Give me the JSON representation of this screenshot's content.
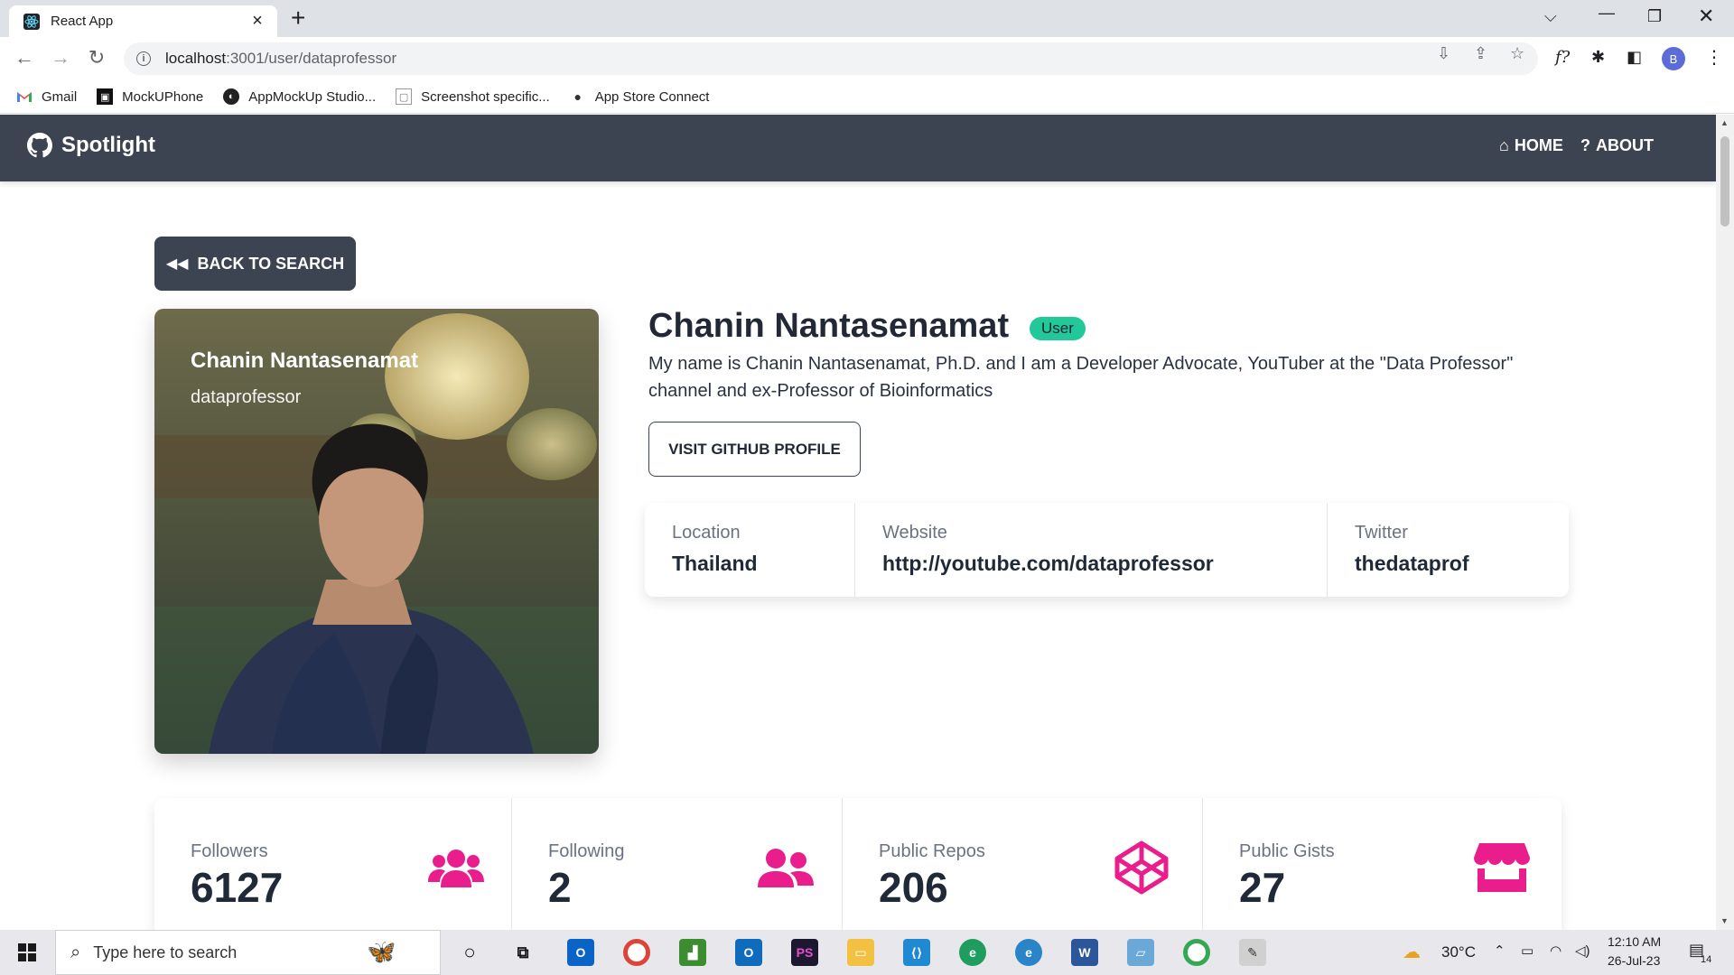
{
  "browser": {
    "tab_title": "React App",
    "url_host": "localhost",
    "url_rest": ":3001/user/dataprofessor",
    "profile_initial": "B",
    "bookmarks": [
      {
        "label": "Gmail",
        "icon": "gmail-icon"
      },
      {
        "label": "MockUPhone",
        "icon": "mockuphone-icon"
      },
      {
        "label": "AppMockUp Studio...",
        "icon": "appmockup-icon"
      },
      {
        "label": "Screenshot specific...",
        "icon": "screenshot-icon"
      },
      {
        "label": "App Store Connect",
        "icon": "apple-icon"
      }
    ]
  },
  "nav": {
    "brand": "Spotlight",
    "home": "HOME",
    "about": "ABOUT"
  },
  "back_button": "BACK TO SEARCH",
  "profile": {
    "name": "Chanin Nantasenamat",
    "login": "dataprofessor",
    "badge": "User",
    "bio": "My name is Chanin Nantasenamat, Ph.D. and I am a Developer Advocate, YouTuber at the \"Data Professor\" channel and ex-Professor of Bioinformatics",
    "visit_button": "VISIT GITHUB PROFILE",
    "info": [
      {
        "label": "Location",
        "value": "Thailand"
      },
      {
        "label": "Website",
        "value": "http://youtube.com/dataprofessor"
      },
      {
        "label": "Twitter",
        "value": "thedataprof"
      }
    ]
  },
  "stats": [
    {
      "label": "Followers",
      "value": "6127",
      "icon": "users-icon"
    },
    {
      "label": "Following",
      "value": "2",
      "icon": "user-friends-icon"
    },
    {
      "label": "Public Repos",
      "value": "206",
      "icon": "codepen-icon"
    },
    {
      "label": "Public Gists",
      "value": "27",
      "icon": "store-icon"
    }
  ],
  "colors": {
    "navbar": "#3d4451",
    "badge": "#22c79a",
    "stat_icon": "#e91e8c"
  },
  "taskbar": {
    "search_placeholder": "Type here to search",
    "temperature": "30°C",
    "time": "12:10 AM",
    "date": "26-Jul-23",
    "notifications": "14"
  }
}
